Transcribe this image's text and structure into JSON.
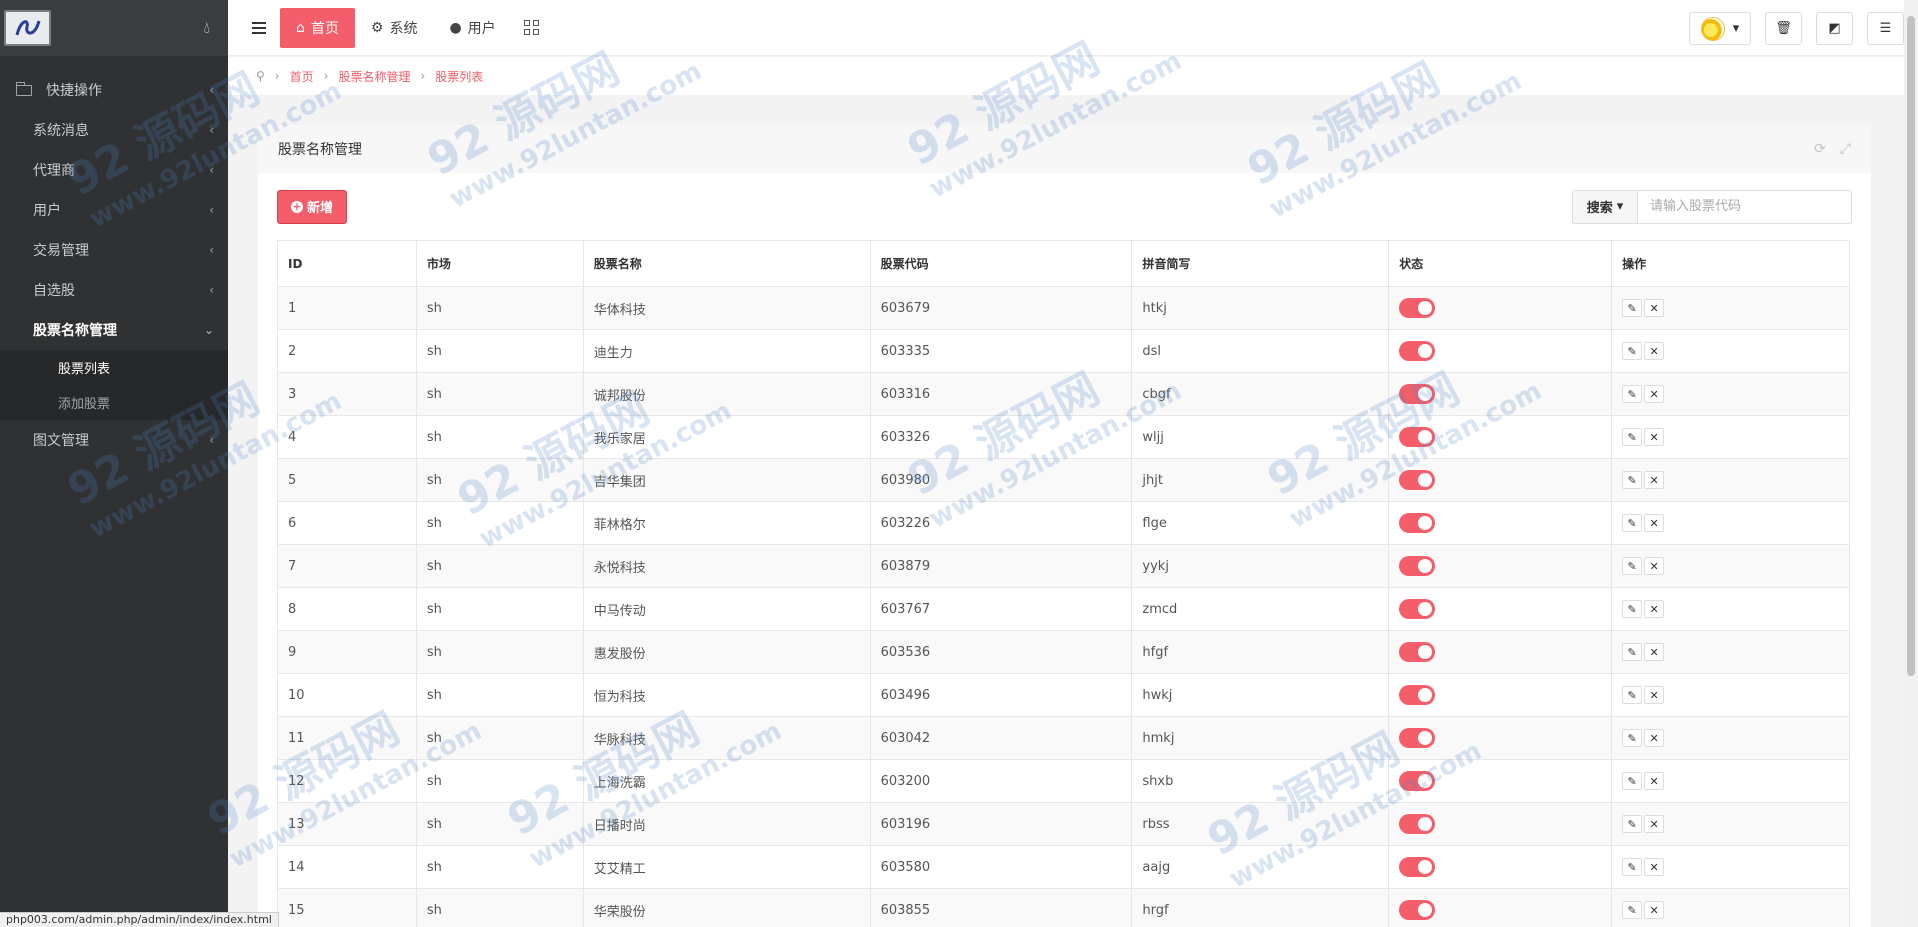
{
  "sidebar": {
    "items": [
      {
        "label": "快捷操作"
      },
      {
        "label": "系统消息"
      },
      {
        "label": "代理商"
      },
      {
        "label": "用户"
      },
      {
        "label": "交易管理"
      },
      {
        "label": "自选股"
      },
      {
        "label": "股票名称管理"
      },
      {
        "label": "图文管理"
      }
    ],
    "sub_items": [
      {
        "label": "股票列表"
      },
      {
        "label": "添加股票"
      }
    ]
  },
  "topbar": {
    "tabs": [
      {
        "label": "首页"
      },
      {
        "label": "系统"
      },
      {
        "label": "用户"
      }
    ]
  },
  "breadcrumb": [
    "首页",
    "股票名称管理",
    "股票列表"
  ],
  "panel": {
    "title": "股票名称管理",
    "add_label": "新增",
    "search_label": "搜索",
    "search_placeholder": "请输入股票代码"
  },
  "table": {
    "headers": [
      "ID",
      "市场",
      "股票名称",
      "股票代码",
      "拼音简写",
      "状态",
      "操作"
    ],
    "rows": [
      [
        "1",
        "sh",
        "华体科技",
        "603679",
        "htkj"
      ],
      [
        "2",
        "sh",
        "迪生力",
        "603335",
        "dsl"
      ],
      [
        "3",
        "sh",
        "诚邦股份",
        "603316",
        "cbgf"
      ],
      [
        "4",
        "sh",
        "我乐家居",
        "603326",
        "wljj"
      ],
      [
        "5",
        "sh",
        "吉华集团",
        "603980",
        "jhjt"
      ],
      [
        "6",
        "sh",
        "菲林格尔",
        "603226",
        "flge"
      ],
      [
        "7",
        "sh",
        "永悦科技",
        "603879",
        "yykj"
      ],
      [
        "8",
        "sh",
        "中马传动",
        "603767",
        "zmcd"
      ],
      [
        "9",
        "sh",
        "惠发股份",
        "603536",
        "hfgf"
      ],
      [
        "10",
        "sh",
        "恒为科技",
        "603496",
        "hwkj"
      ],
      [
        "11",
        "sh",
        "华脉科技",
        "603042",
        "hmkj"
      ],
      [
        "12",
        "sh",
        "上海洗霸",
        "603200",
        "shxb"
      ],
      [
        "13",
        "sh",
        "日播时尚",
        "603196",
        "rbss"
      ],
      [
        "14",
        "sh",
        "艾艾精工",
        "603580",
        "aajg"
      ],
      [
        "15",
        "sh",
        "华荣股份",
        "603855",
        "hrgf"
      ]
    ]
  },
  "statusbar": {
    "url": "php003.com/admin.php/admin/index/index.html"
  },
  "watermark": {
    "big": "92 源码网",
    "small": "www.92luntan.com"
  },
  "colors": {
    "accent": "#f35e6a",
    "sidebar": "#2f3133"
  }
}
